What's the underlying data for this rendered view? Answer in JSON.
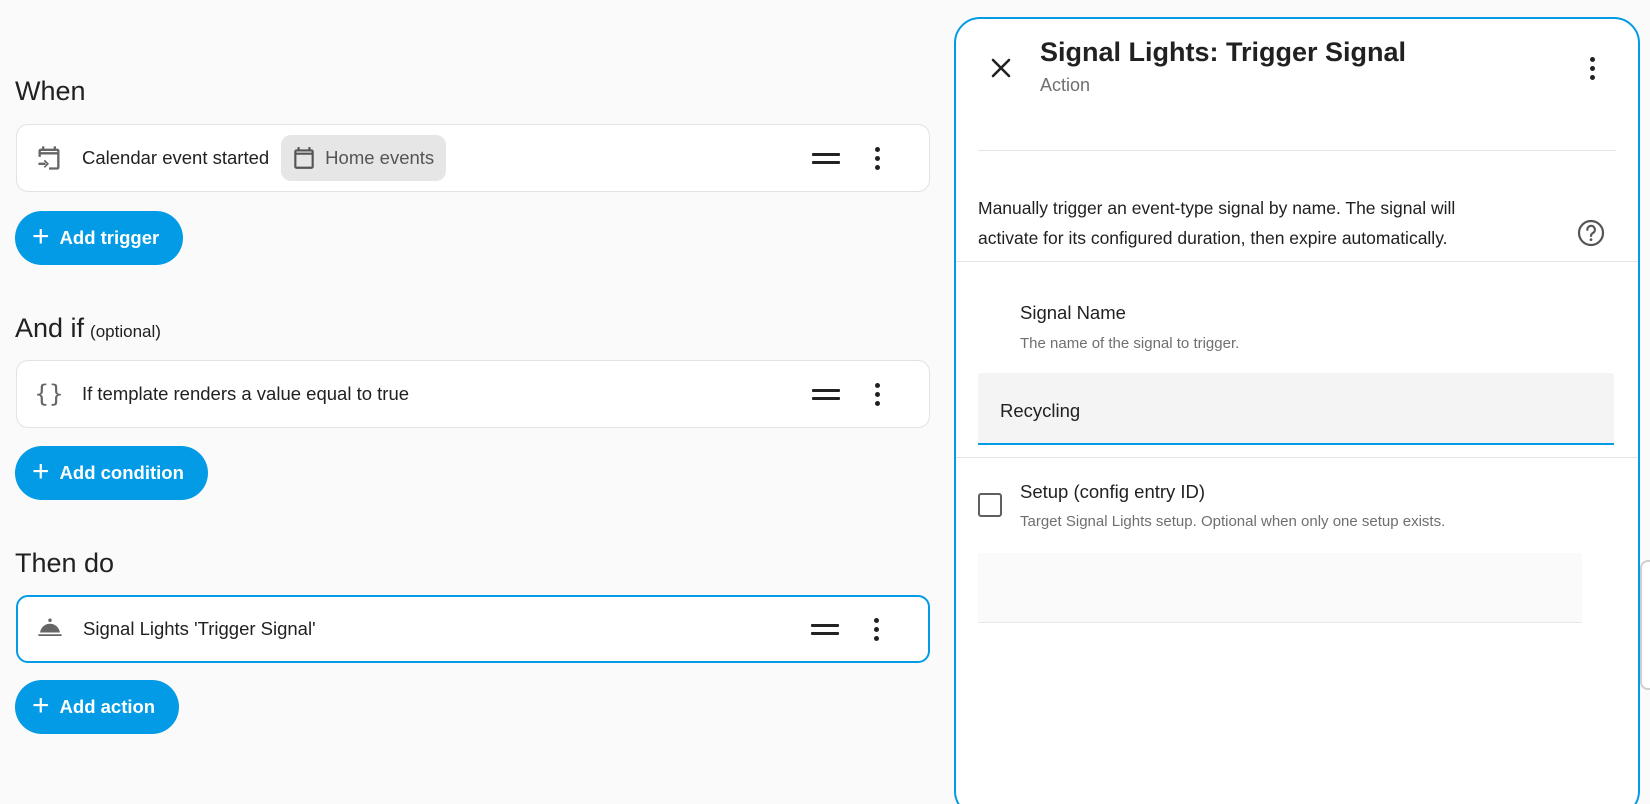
{
  "when": {
    "title": "When",
    "trigger": {
      "label": "Calendar event started",
      "icon": "calendar-start-icon",
      "chip_label": "Home events",
      "chip_icon": "calendar-icon"
    },
    "add_button": "Add trigger"
  },
  "and_if": {
    "title": "And if",
    "optional": "(optional)",
    "condition": {
      "label": "If template renders a value equal to true",
      "icon": "template-braces-icon"
    },
    "add_button": "Add condition"
  },
  "then_do": {
    "title": "Then do",
    "action": {
      "label": "Signal Lights 'Trigger Signal'",
      "icon": "service-bell-icon"
    },
    "add_button": "Add action"
  },
  "panel": {
    "title": "Signal Lights: Trigger Signal",
    "subtitle": "Action",
    "description": "Manually trigger an event-type signal by name. The signal will activate for its configured duration, then expire automatically.",
    "fields": [
      {
        "name": "Signal Name",
        "description": "The name of the signal to trigger.",
        "value": "Recycling"
      },
      {
        "name": "Setup (config entry ID)",
        "description": "Target Signal Lights setup. Optional when only one setup exists.",
        "value": "",
        "checked": false
      }
    ]
  },
  "colors": {
    "accent": "#039be5",
    "background": "#fafafa",
    "card": "#ffffff"
  }
}
